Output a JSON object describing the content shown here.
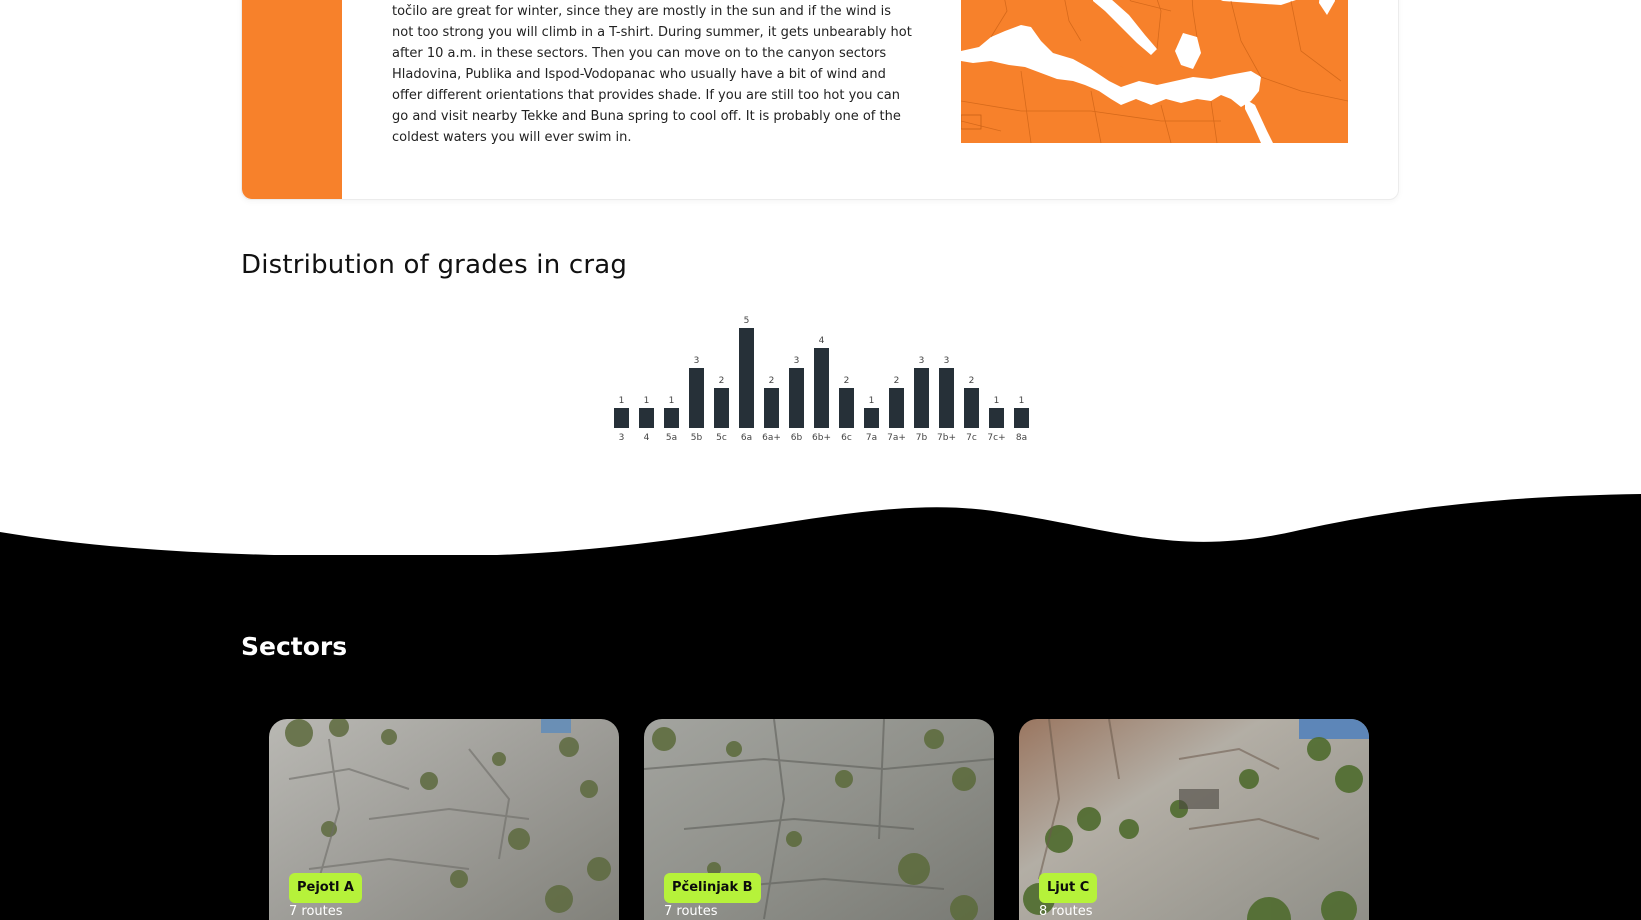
{
  "info": {
    "description": "točilo are great for winter, since they are mostly in the sun and if the wind is not too strong you will climb in a T-shirt. During summer, it gets unbearably hot after 10 a.m. in these sectors. Then you can move on to the canyon sectors Hladovina, Publika and Ispod-Vodopanac who usually have a bit of wind and offer different orientations that provides shade. If you are still too hot you can go and visit nearby Tekke and Buna spring to cool off. It is probably one of the coldest waters you will ever swim in."
  },
  "grades_section": {
    "title": "Distribution of grades in crag"
  },
  "chart_data": {
    "type": "bar",
    "categories": [
      "3",
      "4",
      "5a",
      "5b",
      "5c",
      "6a",
      "6a+",
      "6b",
      "6b+",
      "6c",
      "7a",
      "7a+",
      "7b",
      "7b+",
      "7c",
      "7c+",
      "8a"
    ],
    "values": [
      1,
      1,
      1,
      3,
      2,
      5,
      2,
      3,
      4,
      2,
      1,
      2,
      3,
      3,
      2,
      1,
      1
    ],
    "title": "",
    "xlabel": "",
    "ylabel": "",
    "ylim": [
      0,
      5
    ],
    "grid": false,
    "bar_color": "#263038"
  },
  "sectors_section": {
    "title": "Sectors",
    "cards": [
      {
        "name": "Pejotl A",
        "routes": "7 routes"
      },
      {
        "name": "Pčelinjak B",
        "routes": "7 routes"
      },
      {
        "name": "Ljut C",
        "routes": "8 routes"
      }
    ]
  },
  "colors": {
    "accent": "#f7812b",
    "badge": "#b6f23a",
    "dark": "#000000"
  }
}
